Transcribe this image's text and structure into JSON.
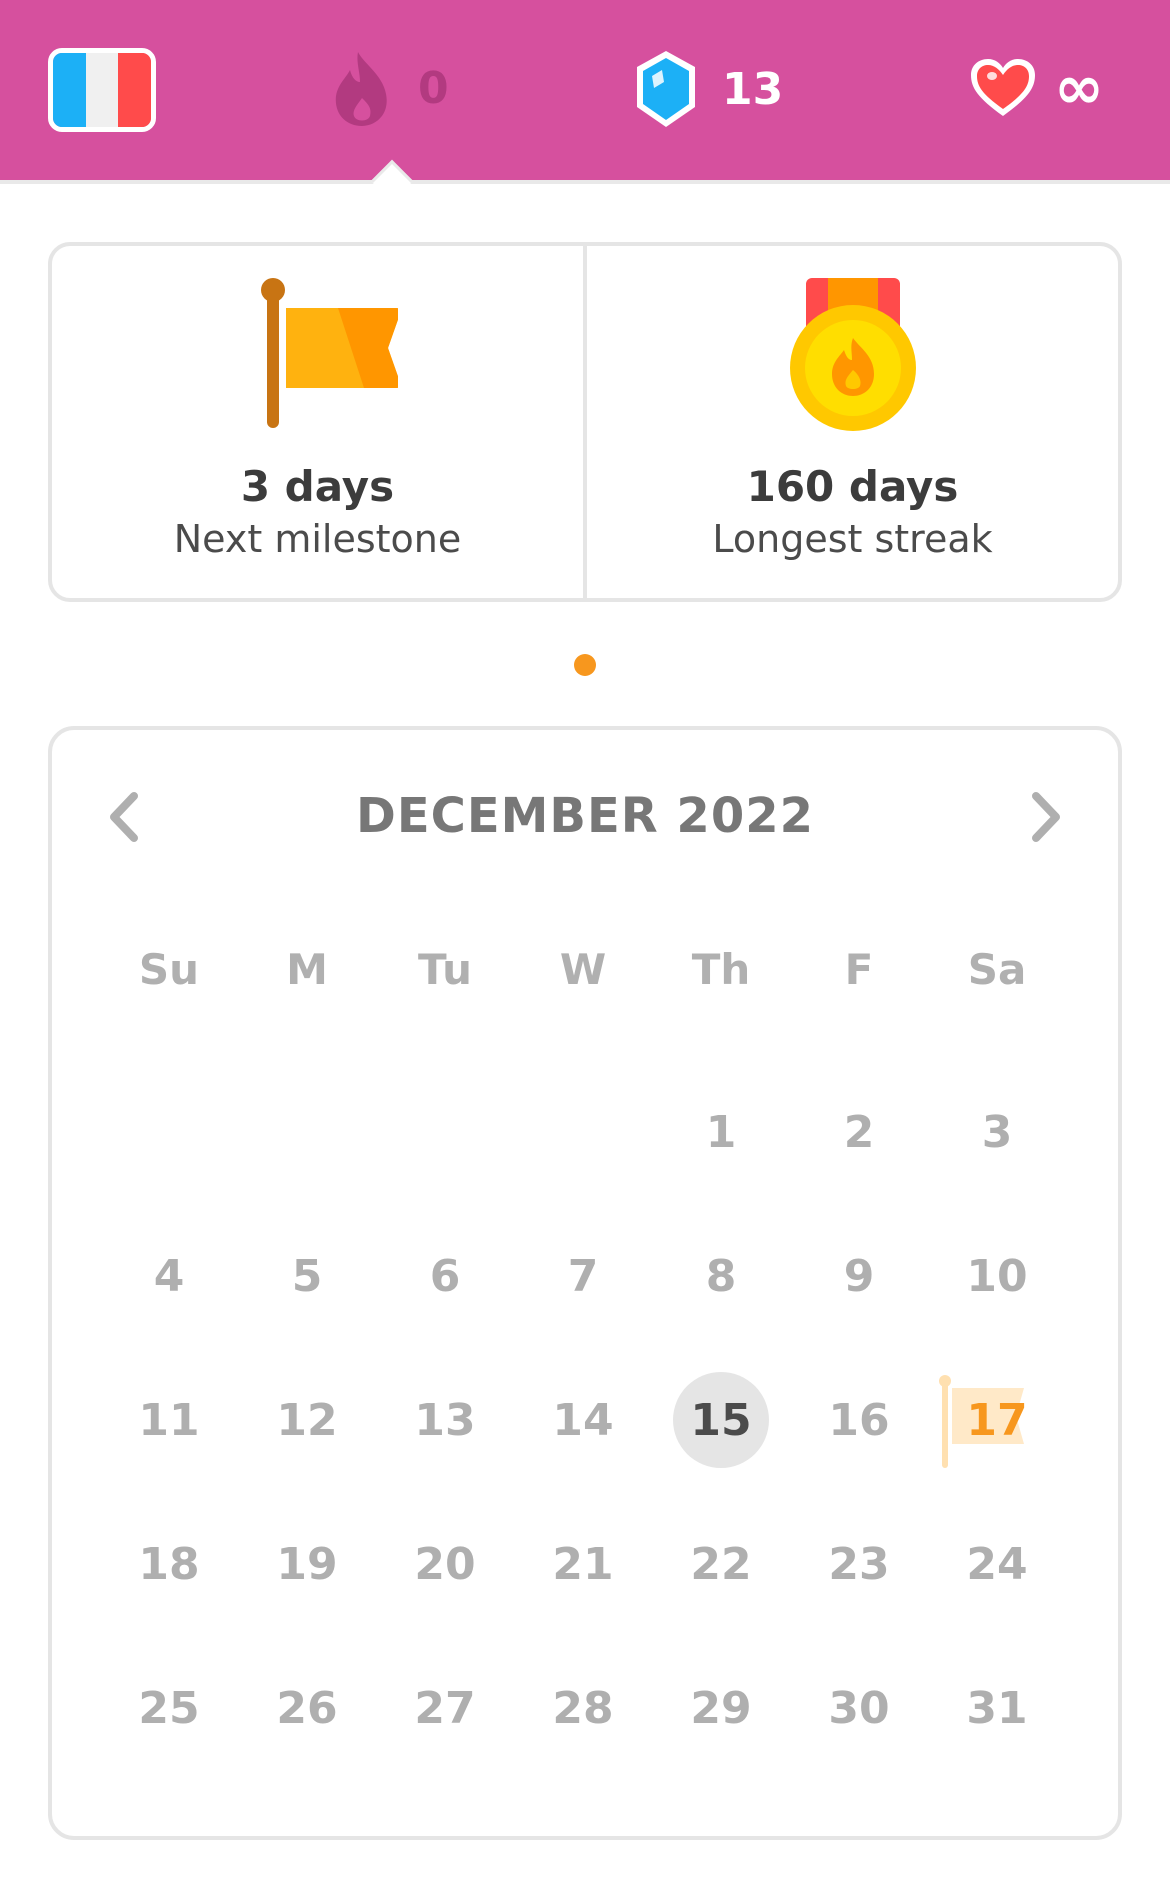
{
  "topbar": {
    "language_flag": {
      "icon": "france-flag-icon",
      "colors": [
        "#1cb0f6",
        "#f0f0f0",
        "#ff4b4b"
      ]
    },
    "streak": {
      "icon": "fire-icon",
      "count": "0"
    },
    "gems": {
      "icon": "gem-icon",
      "count": "13"
    },
    "hearts": {
      "icon": "heart-icon",
      "count": "∞"
    }
  },
  "milestones": [
    {
      "icon": "flag-icon",
      "value": "3 days",
      "label": "Next milestone"
    },
    {
      "icon": "medal-icon",
      "value": "160 days",
      "label": "Longest streak"
    }
  ],
  "calendar": {
    "title": "DECEMBER 2022",
    "weekdays": [
      "Su",
      "M",
      "Tu",
      "W",
      "Th",
      "F",
      "Sa"
    ],
    "first_weekday_index": 4,
    "days_in_month": 31,
    "today": 15,
    "milestone_day": 17,
    "colors": {
      "today_bg": "#e5e5e5",
      "milestone": "#f7971e"
    }
  },
  "colors": {
    "topbar": "#d6509e",
    "accent": "#f7971e"
  }
}
